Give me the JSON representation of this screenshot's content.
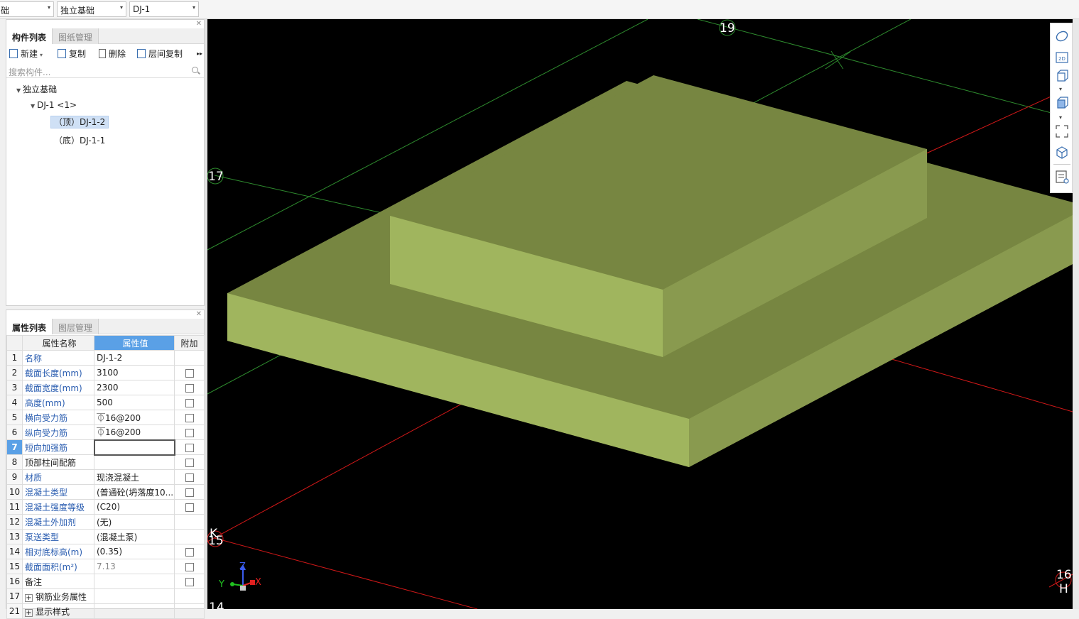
{
  "selectors": {
    "category": "础",
    "type": "独立基础",
    "name": "DJ-1"
  },
  "component_panel": {
    "tabs": [
      "构件列表",
      "图纸管理"
    ],
    "toolbar": {
      "new": "新建",
      "copy": "复制",
      "delete": "删除",
      "floor_copy": "层间复制"
    },
    "search_placeholder": "搜索构件...",
    "tree": {
      "root": "独立基础",
      "child": "DJ-1 <1>",
      "items": [
        "（顶）DJ-1-2",
        "（底）DJ-1-1"
      ],
      "selected_index": 0
    }
  },
  "property_panel": {
    "tabs": [
      "属性列表",
      "图层管理"
    ],
    "headers": {
      "name": "属性名称",
      "value": "属性值",
      "add": "附加"
    },
    "rows": [
      {
        "num": "1",
        "name": "名称",
        "value": "DJ-1-2",
        "blue": true,
        "checkbox": false
      },
      {
        "num": "2",
        "name": "截面长度(mm)",
        "value": "3100",
        "blue": true,
        "checkbox": true
      },
      {
        "num": "3",
        "name": "截面宽度(mm)",
        "value": "2300",
        "blue": true,
        "checkbox": true
      },
      {
        "num": "4",
        "name": "高度(mm)",
        "value": "500",
        "blue": true,
        "checkbox": true
      },
      {
        "num": "5",
        "name": "横向受力筋",
        "value": "⏁16@200",
        "blue": true,
        "checkbox": true
      },
      {
        "num": "6",
        "name": "纵向受力筋",
        "value": "⏁16@200",
        "blue": true,
        "checkbox": true
      },
      {
        "num": "7",
        "name": "短向加强筋",
        "value": "",
        "blue": true,
        "checkbox": true,
        "editing": true
      },
      {
        "num": "8",
        "name": "顶部柱间配筋",
        "value": "",
        "blue": false,
        "checkbox": true
      },
      {
        "num": "9",
        "name": "材质",
        "value": "现浇混凝土",
        "blue": true,
        "checkbox": true
      },
      {
        "num": "10",
        "name": "混凝土类型",
        "value": "(普通砼(坍落度10...",
        "blue": true,
        "checkbox": true
      },
      {
        "num": "11",
        "name": "混凝土强度等级",
        "value": "(C20)",
        "blue": true,
        "checkbox": true
      },
      {
        "num": "12",
        "name": "混凝土外加剂",
        "value": "(无)",
        "blue": true,
        "checkbox": false
      },
      {
        "num": "13",
        "name": "泵送类型",
        "value": "(混凝土泵)",
        "blue": true,
        "checkbox": false
      },
      {
        "num": "14",
        "name": "相对底标高(m)",
        "value": "(0.35)",
        "blue": true,
        "checkbox": true
      },
      {
        "num": "15",
        "name": "截面面积(m²)",
        "value": "7.13",
        "blue": true,
        "checkbox": true,
        "grey": true
      },
      {
        "num": "16",
        "name": "备注",
        "value": "",
        "blue": false,
        "checkbox": true
      },
      {
        "num": "17",
        "name": "钢筋业务属性",
        "value": "",
        "blue": false,
        "checkbox": false,
        "expand": true
      },
      {
        "num": "21",
        "name": "显示样式",
        "value": "",
        "blue": false,
        "checkbox": false,
        "expand": true
      }
    ]
  },
  "viewport": {
    "axis_labels": {
      "a": "19",
      "b": "17",
      "c": "15",
      "d": "16",
      "e": "H",
      "f": "K",
      "g": "14"
    },
    "gizmo": {
      "x": "X",
      "y": "Y",
      "z": "Z"
    },
    "colors": {
      "top_face": "#778641",
      "side_light": "#a0b55e",
      "side_dark": "#899a4f",
      "grid_green": "#2e8b2e",
      "grid_red": "#d01818"
    }
  },
  "view_tools": [
    "orbit-icon",
    "2d-icon",
    "3d-view-icon",
    "3d-solid-icon",
    "fullscreen-icon",
    "cube-view-icon",
    "properties-view-icon"
  ]
}
